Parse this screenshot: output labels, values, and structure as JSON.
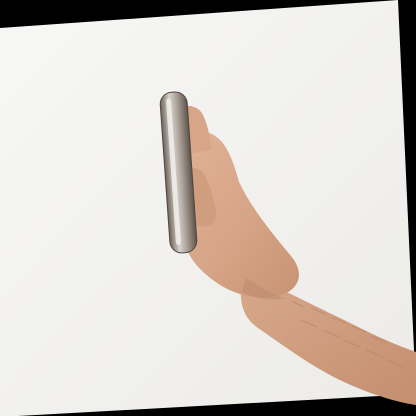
{
  "image": {
    "description_tags": [
      "hand",
      "smartphone",
      "side-view",
      "forearm"
    ],
    "colors": {
      "frame": "#000000",
      "background": "#f1f1ef",
      "skin": "#d9a889",
      "skin_shadow": "#b9876a",
      "phone_body": "#8d8177",
      "phone_highlight": "#d7d2cd",
      "phone_edge": "#5f554d"
    }
  }
}
